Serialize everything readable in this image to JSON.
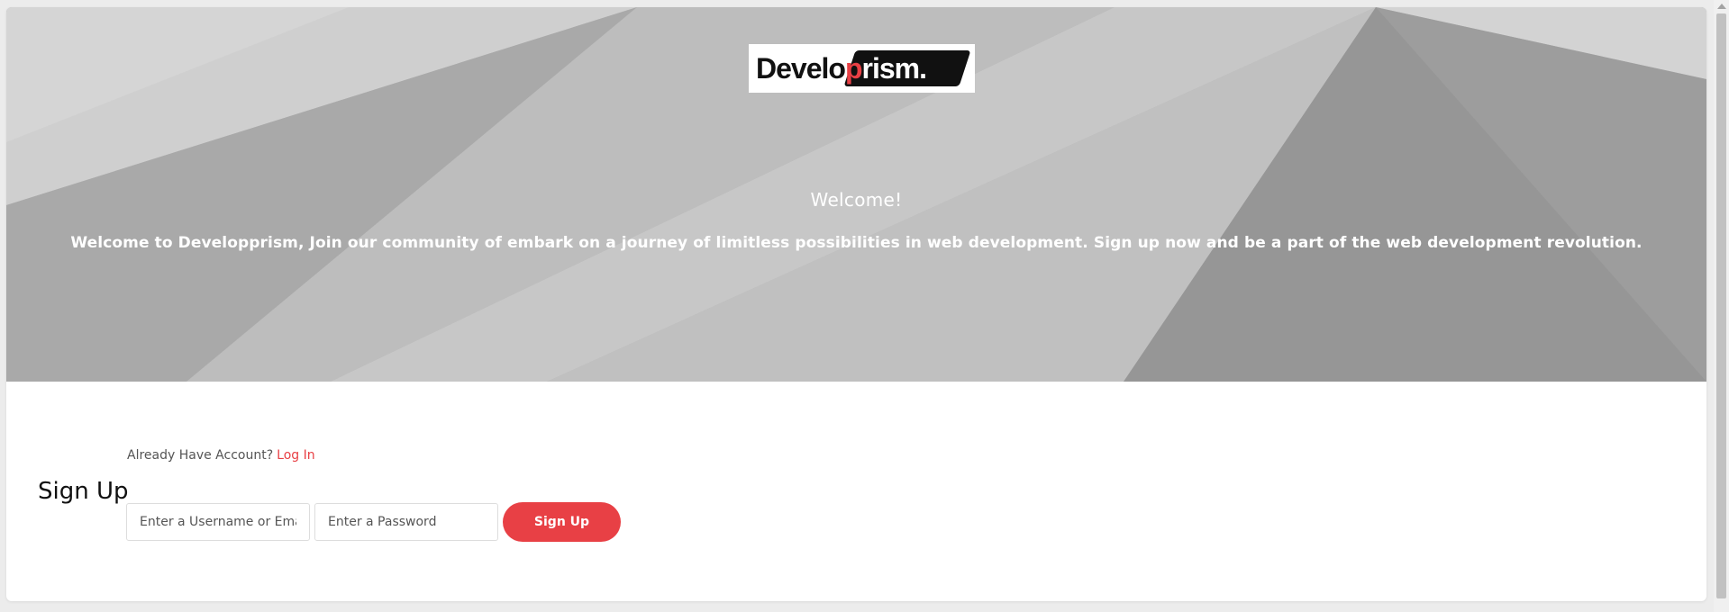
{
  "brand": {
    "logo_text_dark": "Develo",
    "logo_text_accent": "p",
    "logo_text_light": "rism.",
    "accent_color": "#e84045"
  },
  "hero": {
    "title": "Welcome!",
    "message": "Welcome to Developprism, Join our community of embark on a journey of limitless possibilities in web development. Sign up now and be a part of the web development revolution."
  },
  "auth": {
    "already_text": "Already Have Account?",
    "login_link": "Log In",
    "heading": "Sign Up",
    "username_placeholder": "Enter a Username or Email",
    "password_placeholder": "Enter a Password",
    "submit_label": "Sign Up"
  }
}
